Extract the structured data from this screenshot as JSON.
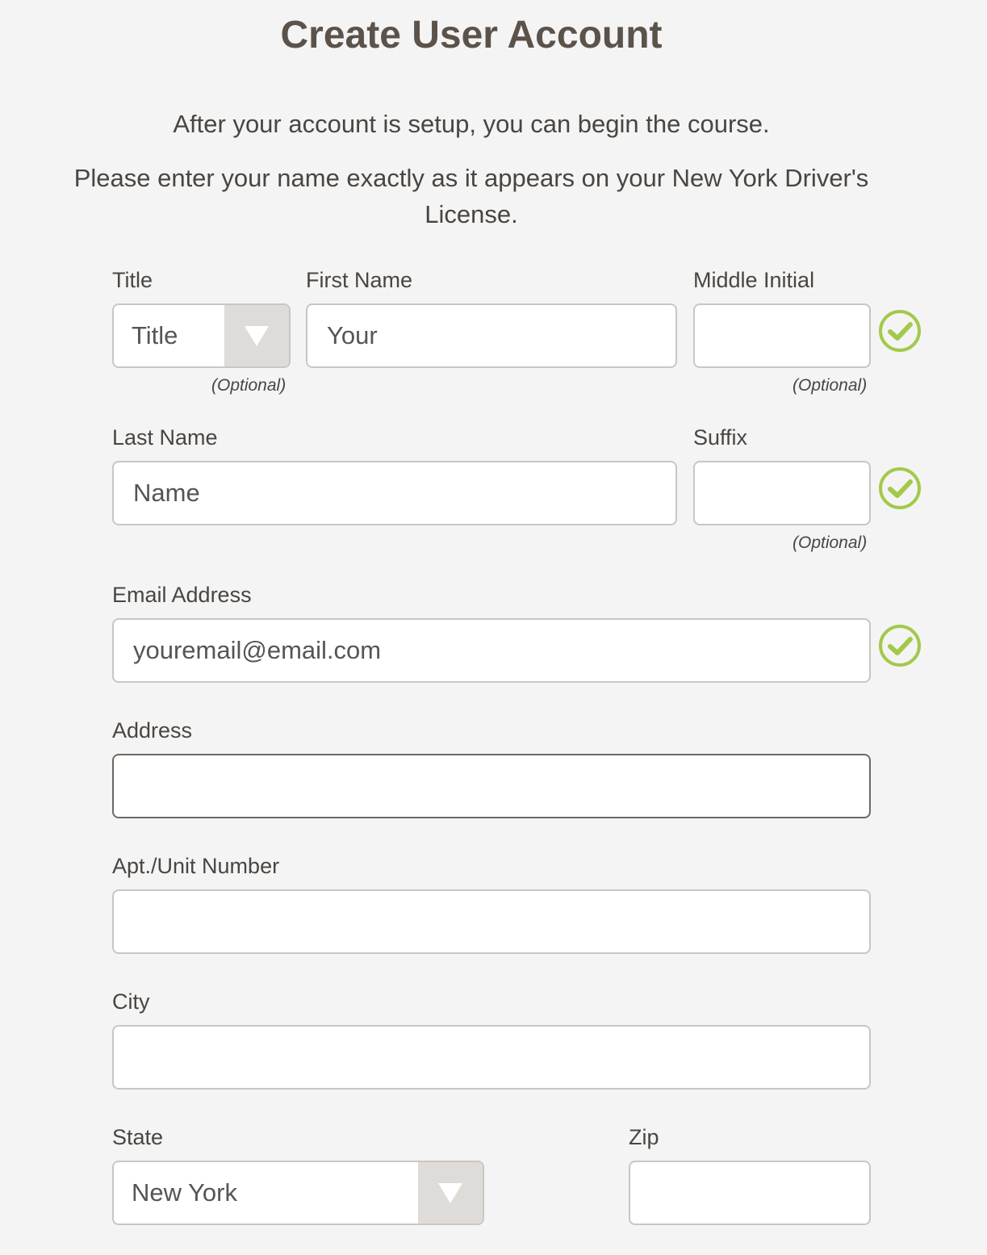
{
  "header": {
    "title": "Create User Account",
    "intro_line_1": "After your account is setup, you can begin the course.",
    "intro_line_2": "Please enter your name exactly as it appears on your New York Driver's License."
  },
  "form": {
    "title_field": {
      "label": "Title",
      "value": "Title",
      "note": "(Optional)"
    },
    "first_name": {
      "label": "First Name",
      "value": "Your"
    },
    "middle_initial": {
      "label": "Middle Initial",
      "value": "",
      "note": "(Optional)"
    },
    "last_name": {
      "label": "Last Name",
      "value": "Name"
    },
    "suffix": {
      "label": "Suffix",
      "value": "",
      "note": "(Optional)"
    },
    "email": {
      "label": "Email Address",
      "value": "youremail@email.com"
    },
    "address": {
      "label": "Address",
      "value": ""
    },
    "apt": {
      "label": "Apt./Unit Number",
      "value": ""
    },
    "city": {
      "label": "City",
      "value": ""
    },
    "state": {
      "label": "State",
      "value": "New York"
    },
    "zip": {
      "label": "Zip",
      "value": ""
    }
  },
  "icons": {
    "valid": "check-circle-icon",
    "dropdown": "triangle-down-icon"
  },
  "colors": {
    "valid_green": "#a3c94a",
    "background": "#f4f4f4",
    "text": "#4a4540"
  }
}
